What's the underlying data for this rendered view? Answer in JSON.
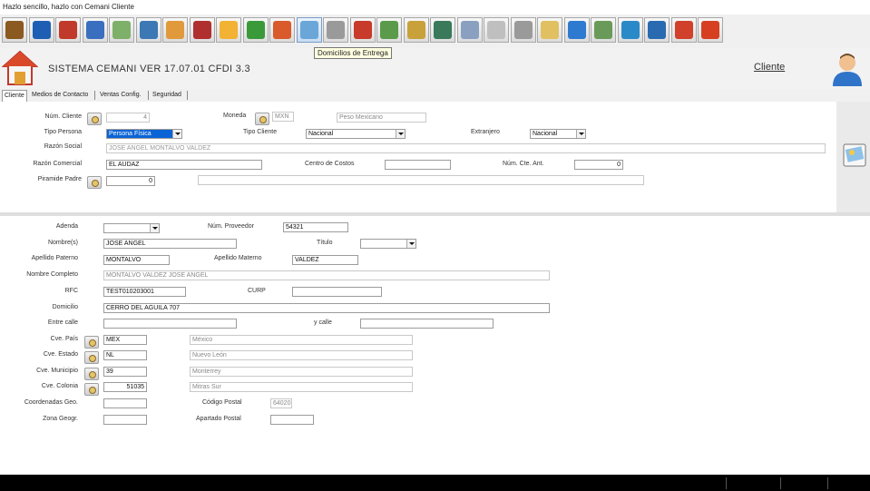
{
  "window": {
    "title": "Hazlo sencillo, hazlo con Cemani Cliente"
  },
  "toolbar": {
    "icons": [
      "exit-icon",
      "save-icon",
      "chart-icon",
      "map-icon",
      "money-icon",
      "users-icon",
      "user-icon",
      "rose-icon",
      "sun-icon",
      "shield-icon",
      "home-icon",
      "delivery-address-icon",
      "printer-100-icon",
      "invoice-icon",
      "cash-icon",
      "edit-icon",
      "tools-icon",
      "search-icon",
      "hang-tag-icon",
      "paperclip-icon",
      "deer-icon",
      "contact-icon",
      "scale-icon",
      "recycle-icon",
      "trash-icon",
      "cancel-icon",
      "help-icon"
    ],
    "colors": [
      "#8a5a20",
      "#1e5fb4",
      "#c0392b",
      "#3a6fbf",
      "#7fb069",
      "#3c78b4",
      "#e09a3c",
      "#b03030",
      "#f2b233",
      "#3a9a3a",
      "#d95a2b",
      "#6aa6d8",
      "#9a9a9a",
      "#c83a2a",
      "#5a9a4a",
      "#c9a13a",
      "#3a7a5a",
      "#8aa0c0",
      "#bfbfbf",
      "#9a9a9a",
      "#e0c060",
      "#2e7ad0",
      "#6a9a5a",
      "#2a8ac8",
      "#2a6ab0",
      "#d0402a",
      "#d64020"
    ],
    "tooltip": "Domicilios de Entrega"
  },
  "header": {
    "title": "SISTEMA CEMANI VER 17.07.01 CFDI 3.3",
    "link": "Cliente"
  },
  "tabs": [
    "Cliente",
    "Medios de Contacto",
    "Ventas Config.",
    "Seguridad"
  ],
  "general": {
    "num_cliente_label": "Núm. Cliente",
    "num_cliente": "4",
    "moneda_label": "Moneda",
    "moneda_code": "MXN",
    "moneda_name": "Peso Mexicano",
    "tipo_persona_label": "Tipo Persona",
    "tipo_persona": "Persona Física",
    "tipo_cliente_label": "Tipo Cliente",
    "tipo_cliente": "Nacional",
    "extranjero_label": "Extranjero",
    "extranjero": "Nacional",
    "razon_social_label": "Razón Social",
    "razon_social": "JOSE ANGEL MONTALVO VALDEZ",
    "razon_comercial_label": "Razón Comercial",
    "razon_comercial": "EL AUDAZ",
    "centro_costos_label": "Centro de Costos",
    "centro_costos": "",
    "num_cte_ant_label": "Núm. Cte. Ant.",
    "num_cte_ant": "0",
    "piramide_padre_label": "Piramide Padre",
    "piramide_padre": "0",
    "piramide_desc": ""
  },
  "detail": {
    "adenda_label": "Adenda",
    "adenda": "",
    "num_proveedor_label": "Núm. Proveedor",
    "num_proveedor": "54321",
    "nombres_label": "Nombre(s)",
    "nombres": "JOSE ANGEL",
    "titulo_label": "Título",
    "titulo": "",
    "apellido_paterno_label": "Apellido Paterno",
    "apellido_paterno": "MONTALVO",
    "apellido_materno_label": "Apellido Materno",
    "apellido_materno": "VALDEZ",
    "nombre_completo_label": "Nombre Completo",
    "nombre_completo": "MONTALVO VALDEZ JOSE ANGEL",
    "rfc_label": "RFC",
    "rfc": "TEST010203001",
    "curp_label": "CURP",
    "curp": "",
    "domicilio_label": "Domicilio",
    "domicilio": "CERRO DEL AGUILA 707",
    "entre_calle_label": "Entre calle",
    "entre_calle": "",
    "y_calle_label": "y calle",
    "y_calle": "",
    "cve_pais_label": "Cve. País",
    "cve_pais": "MEX",
    "pais": "México",
    "cve_estado_label": "Cve. Estado",
    "cve_estado": "NL",
    "estado": "Nuevo León",
    "cve_municipio_label": "Cve. Municipio",
    "cve_municipio": "39",
    "municipio": "Monterrey",
    "cve_colonia_label": "Cve. Colonia",
    "cve_colonia": "51035",
    "colonia": "Mitras Sur",
    "coordenadas_label": "Coordenadas Geo.",
    "coordenadas": "",
    "codigo_postal_label": "Código Postal",
    "codigo_postal": "64020",
    "zona_geogr_label": "Zona Geogr.",
    "zona_geogr": "",
    "apartado_postal_label": "Apartado Postal",
    "apartado_postal": ""
  }
}
